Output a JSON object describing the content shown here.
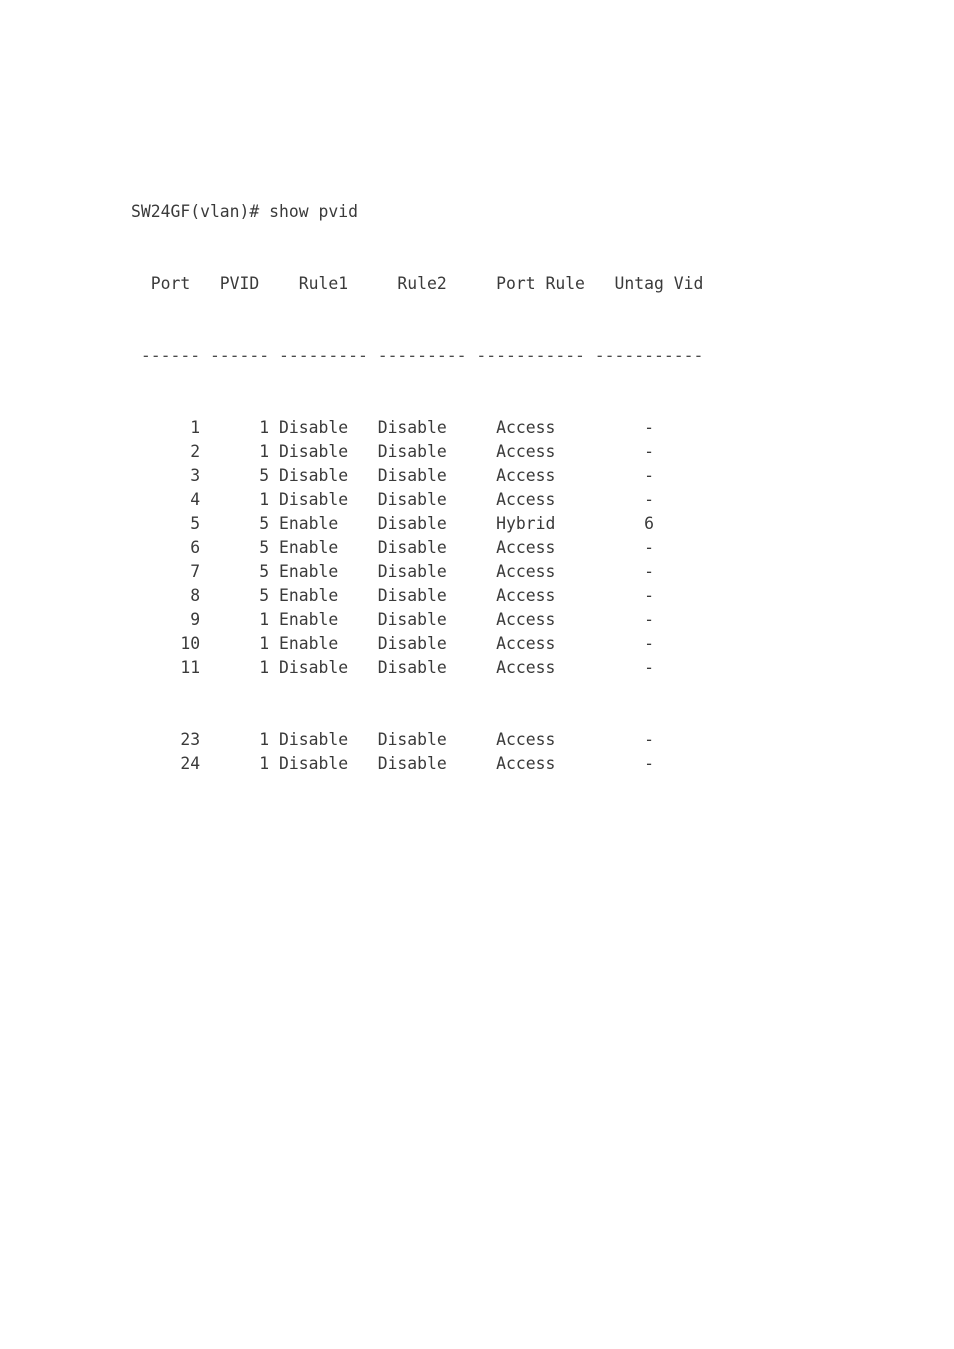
{
  "terminal": {
    "prompt": "SW24GF(vlan)#",
    "command": "show pvid",
    "prompt_line": "SW24GF(vlan)# show pvid",
    "text_color": "#3a3a3a",
    "background_color": "#ffffff"
  },
  "table": {
    "columns": [
      {
        "header": "Port",
        "width": 6,
        "align": "right",
        "separator": "------"
      },
      {
        "header": "PVID",
        "width": 6,
        "align": "right",
        "separator": "------"
      },
      {
        "header": "Rule1",
        "width": 9,
        "align": "left",
        "separator": "---------"
      },
      {
        "header": "Rule2",
        "width": 9,
        "align": "left",
        "separator": "---------"
      },
      {
        "header": "Port Rule",
        "width": 11,
        "align": "center",
        "separator": "-----------"
      },
      {
        "header": "Untag Vid",
        "width": 11,
        "align": "center",
        "separator": "-----------"
      }
    ],
    "header_line": "  Port   PVID    Rule1     Rule2     Port Rule   Untag Vid",
    "separator_line": " ------ ------ --------- --------- ----------- -----------",
    "rows": [
      {
        "port": "1",
        "pvid": "1",
        "rule1": "Disable",
        "rule2": "Disable",
        "port_rule": "Access",
        "untag_vid": "-"
      },
      {
        "port": "2",
        "pvid": "1",
        "rule1": "Disable",
        "rule2": "Disable",
        "port_rule": "Access",
        "untag_vid": "-"
      },
      {
        "port": "3",
        "pvid": "5",
        "rule1": "Disable",
        "rule2": "Disable",
        "port_rule": "Access",
        "untag_vid": "-"
      },
      {
        "port": "4",
        "pvid": "1",
        "rule1": "Disable",
        "rule2": "Disable",
        "port_rule": "Access",
        "untag_vid": "-"
      },
      {
        "port": "5",
        "pvid": "5",
        "rule1": "Enable",
        "rule2": "Disable",
        "port_rule": "Hybrid",
        "untag_vid": "6"
      },
      {
        "port": "6",
        "pvid": "5",
        "rule1": "Enable",
        "rule2": "Disable",
        "port_rule": "Access",
        "untag_vid": "-"
      },
      {
        "port": "7",
        "pvid": "5",
        "rule1": "Enable",
        "rule2": "Disable",
        "port_rule": "Access",
        "untag_vid": "-"
      },
      {
        "port": "8",
        "pvid": "5",
        "rule1": "Enable",
        "rule2": "Disable",
        "port_rule": "Access",
        "untag_vid": "-"
      },
      {
        "port": "9",
        "pvid": "1",
        "rule1": "Enable",
        "rule2": "Disable",
        "port_rule": "Access",
        "untag_vid": "-"
      },
      {
        "port": "10",
        "pvid": "1",
        "rule1": "Enable",
        "rule2": "Disable",
        "port_rule": "Access",
        "untag_vid": "-"
      },
      {
        "port": "11",
        "pvid": "1",
        "rule1": "Disable",
        "rule2": "Disable",
        "port_rule": "Access",
        "untag_vid": "-"
      },
      {
        "port": "",
        "pvid": "",
        "rule1": "",
        "rule2": "",
        "port_rule": "",
        "untag_vid": "",
        "blank": true
      },
      {
        "port": "",
        "pvid": "",
        "rule1": "",
        "rule2": "",
        "port_rule": "",
        "untag_vid": "",
        "blank": true
      },
      {
        "port": "23",
        "pvid": "1",
        "rule1": "Disable",
        "rule2": "Disable",
        "port_rule": "Access",
        "untag_vid": "-"
      },
      {
        "port": "24",
        "pvid": "1",
        "rule1": "Disable",
        "rule2": "Disable",
        "port_rule": "Access",
        "untag_vid": "-"
      }
    ]
  }
}
